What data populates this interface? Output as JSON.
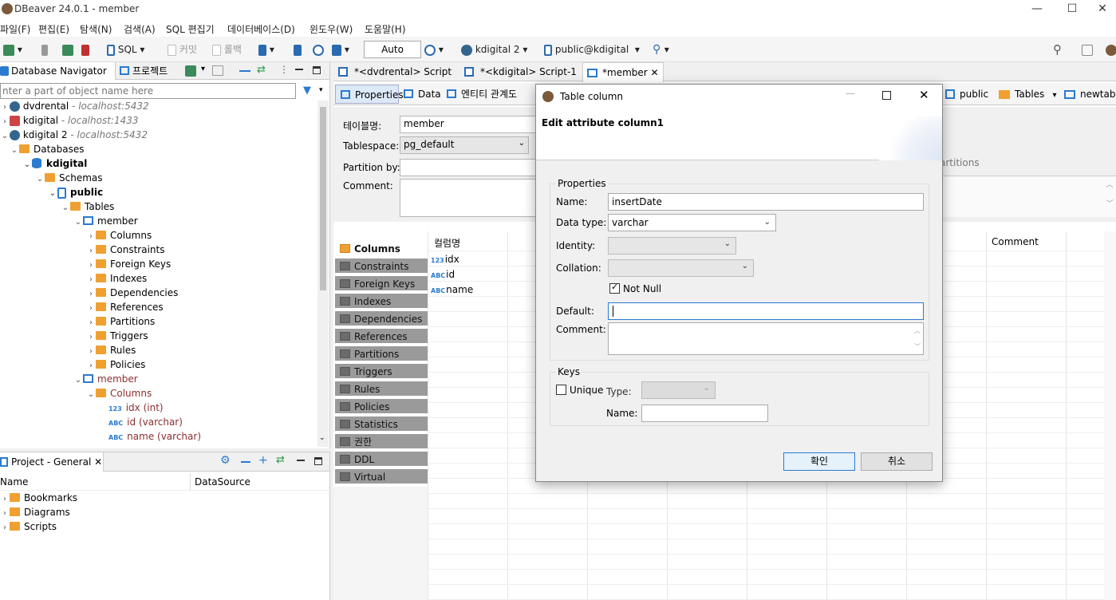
{
  "window": {
    "title": "DBeaver 24.0.1 - member",
    "minimize": "—",
    "maximize": "☐",
    "close": "✕"
  },
  "menu": [
    "파일(F)",
    "편집(E)",
    "탐색(N)",
    "검색(A)",
    "SQL 편집기",
    "데이터베이스(D)",
    "윈도우(W)",
    "도움말(H)"
  ],
  "toolbar": {
    "sql": "SQL",
    "commit": "커밋",
    "rollback": "롤백",
    "transaction_mode": "Auto",
    "connection": "kdigital 2",
    "schema": "public@kdigital"
  },
  "navigator": {
    "tab_label": "Database Navigator",
    "projects_tab": "프로젝트",
    "filter_placeholder": "nter a part of object name here",
    "connections": [
      {
        "name": "dvdrental",
        "host": "- localhost:5432"
      },
      {
        "name": "kdigital",
        "host": "- localhost:1433"
      },
      {
        "name": "kdigital 2",
        "host": "- localhost:5432"
      }
    ],
    "databases": "Databases",
    "db_name": "kdigital",
    "schemas": "Schemas",
    "schema_name": "public",
    "tables": "Tables",
    "table1": "member",
    "table1_children": [
      "Columns",
      "Constraints",
      "Foreign Keys",
      "Indexes",
      "Dependencies",
      "References",
      "Partitions",
      "Triggers",
      "Rules",
      "Policies"
    ],
    "table2": "member",
    "table2_columns_label": "Columns",
    "table2_columns": [
      {
        "name": "idx (int)",
        "type": "123"
      },
      {
        "name": "id (varchar)",
        "type": "ABC"
      },
      {
        "name": "name (varchar)",
        "type": "ABC"
      }
    ]
  },
  "project": {
    "tab_label": "Project - General",
    "col_name": "Name",
    "col_datasource": "DataSource",
    "items": [
      "Bookmarks",
      "Diagrams",
      "Scripts"
    ]
  },
  "editor": {
    "tabs": [
      "*<dvdrental> Script",
      "*<kdigital> Script-1",
      "*member"
    ],
    "subtabs": [
      "Properties",
      "Data",
      "엔티티 관계도"
    ],
    "breadcrumb": [
      "public",
      "Tables",
      "newtable"
    ],
    "table_name_label": "테이블명:",
    "table_name": "member",
    "tablespace_label": "Tablespace:",
    "tablespace": "pg_default",
    "partition_label": "Partition by:",
    "comment_label": "Comment:",
    "partitions_hint": "artitions",
    "side_tabs": [
      "Columns",
      "Constraints",
      "Foreign Keys",
      "Indexes",
      "Dependencies",
      "References",
      "Partitions",
      "Triggers",
      "Rules",
      "Policies",
      "Statistics",
      "권한",
      "DDL",
      "Virtual"
    ],
    "grid_header": "컬럼명",
    "grid_comment_header": "Comment",
    "grid_rows": [
      {
        "name": "idx",
        "type": "123"
      },
      {
        "name": "id",
        "type": "ABC"
      },
      {
        "name": "name",
        "type": "ABC"
      }
    ]
  },
  "dialog": {
    "title": "Table column",
    "heading": "Edit attribute column1",
    "properties_group": "Properties",
    "name_label": "Name:",
    "name_value": "insertDate",
    "datatype_label": "Data type:",
    "datatype_value": "varchar",
    "identity_label": "Identity:",
    "collation_label": "Collation:",
    "notnull_label": "Not Null",
    "default_label": "Default:",
    "default_value": "",
    "comment_label": "Comment:",
    "keys_group": "Keys",
    "unique_label": "Unique",
    "type_label": "Type:",
    "keyname_label": "Name:",
    "ok": "확인",
    "cancel": "취소"
  },
  "colors": {
    "accent": "#2a7ad0",
    "folder": "#f0a030",
    "selected_tab": "#dce9f7"
  }
}
